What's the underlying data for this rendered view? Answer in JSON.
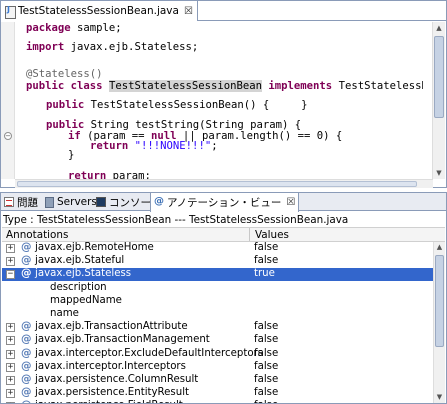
{
  "editor": {
    "tab_label": "TestStatelessSessionBean.java",
    "close_glyph": "☒",
    "code": {
      "l1_kw": "package",
      "l1_rest": " sample;",
      "l2_kw": "import",
      "l2_rest": " javax.ejb.Stateless;",
      "l3_ann": "@Stateless()",
      "l4_kw": "public class",
      "l4_hl": "TestStatelessSessionBean",
      "l4_kw2": "implements",
      "l4_rest": " TestStatelessRemote {",
      "l5_kw": "public",
      "l5_rest": " TestStatelessSessionBean() {     }",
      "l6_kw": "public",
      "l6_rest": " String testString(String param) {",
      "l7_kw": "if",
      "l7_a": " (param == ",
      "l7_kw2": "null",
      "l7_b": " || param.length() == 0) {",
      "l8_kw": "return",
      "l8_str": " \"!!!NONE!!!\"",
      "l8_rest": ";",
      "l9": "}",
      "l10_kw": "return",
      "l10_rest": " param;"
    }
  },
  "views": {
    "tabs": [
      {
        "label": "問題"
      },
      {
        "label": "Servers"
      },
      {
        "label": "コンソール"
      },
      {
        "label": "アノテーション・ビュー"
      }
    ],
    "close_glyph": "☒",
    "type_line": "Type : TestStatelessSessionBean --- TestStatelessSessionBean.java",
    "columns": {
      "annotations": "Annotations",
      "values": "Values"
    },
    "rows": [
      {
        "name": "javax.ejb.RemoteHome",
        "value": "false",
        "expander": "+"
      },
      {
        "name": "javax.ejb.Stateful",
        "value": "false",
        "expander": "+"
      },
      {
        "name": "javax.ejb.Stateless",
        "value": "true",
        "expander": "−",
        "selected": true
      },
      {
        "name": "description",
        "value": ""
      },
      {
        "name": "mappedName",
        "value": ""
      },
      {
        "name": "name",
        "value": ""
      },
      {
        "name": "javax.ejb.TransactionAttribute",
        "value": "false",
        "expander": "+"
      },
      {
        "name": "javax.ejb.TransactionManagement",
        "value": "false",
        "expander": "+"
      },
      {
        "name": "javax.interceptor.ExcludeDefaultInterceptors",
        "value": "false",
        "expander": "+"
      },
      {
        "name": "javax.interceptor.Interceptors",
        "value": "false",
        "expander": "+"
      },
      {
        "name": "javax.persistence.ColumnResult",
        "value": "false",
        "expander": "+"
      },
      {
        "name": "javax.persistence.EntityResult",
        "value": "false",
        "expander": "+"
      },
      {
        "name": "javax.persistence.FieldResult",
        "value": "false",
        "expander": "+"
      }
    ]
  },
  "icons": {
    "java_file": "java-file-icon",
    "problems": "problems-icon",
    "servers": "servers-icon",
    "console": "console-icon",
    "annotation_view": "annotation-view-icon",
    "annotation": "at-icon"
  },
  "colors": {
    "keyword": "#7f0055",
    "annotation": "#646464",
    "string": "#2a00ff",
    "selection": "#3366cc",
    "tab_border": "#8a9bb8"
  }
}
